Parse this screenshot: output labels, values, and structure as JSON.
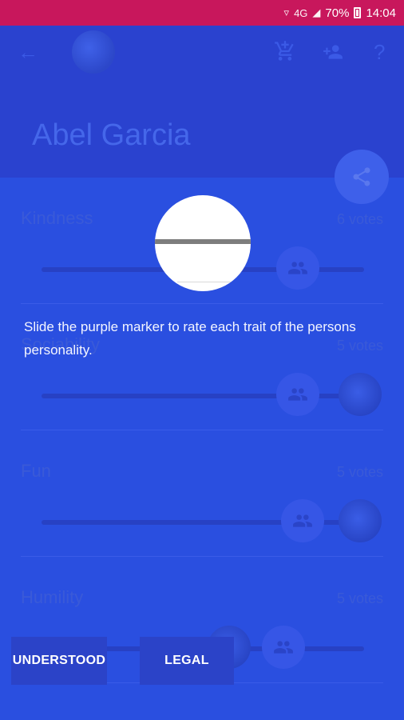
{
  "status_bar": {
    "signal": "4G",
    "battery": "70%",
    "time": "14:04"
  },
  "toolbar": {
    "back_icon": "arrow-left-icon",
    "icons": [
      "cart-add-icon",
      "person-add-icon",
      "help-icon"
    ]
  },
  "profile": {
    "name": "Abel Garcia"
  },
  "traits": [
    {
      "label": "Kindness",
      "votes": "6 votes"
    },
    {
      "label": "Sociability",
      "votes": "5 votes"
    },
    {
      "label": "Fun",
      "votes": "5 votes"
    },
    {
      "label": "Humility",
      "votes": "5 votes"
    }
  ],
  "tutorial": {
    "hint": "Slide the purple marker to rate each trait of the persons personality."
  },
  "buttons": {
    "understood": "UNDERSTOOD",
    "legal": "LEGAL"
  },
  "colors": {
    "status_bar": "#c8175c",
    "overlay_blue": "#2a4fe0",
    "header_blue": "#2a42cf"
  }
}
